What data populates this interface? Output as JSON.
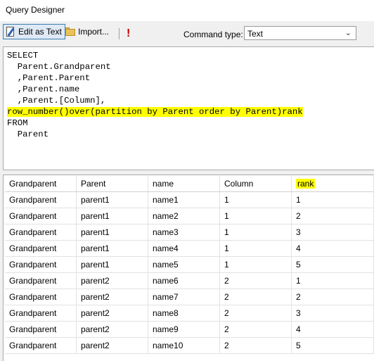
{
  "window": {
    "title": "Query Designer"
  },
  "toolbar": {
    "edit_as_text": "Edit as Text",
    "import": "Import...",
    "run_symbol": "!",
    "command_type_label": "Command type:",
    "command_type_value": "Text"
  },
  "editor": {
    "lines": [
      "SELECT",
      "  Parent.Grandparent",
      "  ,Parent.Parent",
      "  ,Parent.name",
      "  ,Parent.[Column],",
      "row_number()over(partition by Parent order by Parent)rank",
      "FROM",
      "  Parent"
    ]
  },
  "results": {
    "columns": [
      "Grandparent",
      "Parent",
      "name",
      "Column",
      "rank"
    ],
    "rows": [
      [
        "Grandparent",
        "parent1",
        "name1",
        "1",
        "1"
      ],
      [
        "Grandparent",
        "parent1",
        "name2",
        "1",
        "2"
      ],
      [
        "Grandparent",
        "parent1",
        "name3",
        "1",
        "3"
      ],
      [
        "Grandparent",
        "parent1",
        "name4",
        "1",
        "4"
      ],
      [
        "Grandparent",
        "parent1",
        "name5",
        "1",
        "5"
      ],
      [
        "Grandparent",
        "parent2",
        "name6",
        "2",
        "1"
      ],
      [
        "Grandparent",
        "parent2",
        "name7",
        "2",
        "2"
      ],
      [
        "Grandparent",
        "parent2",
        "name8",
        "2",
        "3"
      ],
      [
        "Grandparent",
        "parent2",
        "name9",
        "2",
        "4"
      ],
      [
        "Grandparent",
        "parent2",
        "name10",
        "2",
        "5"
      ]
    ]
  },
  "colors": {
    "highlight": "#ffff00",
    "run_icon": "#c00000"
  }
}
